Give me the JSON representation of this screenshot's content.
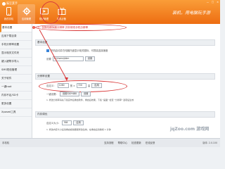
{
  "app": {
    "title": "豌豆荚手"
  },
  "toolbar": [
    {
      "label": "我的手机",
      "icon": "phone-icon"
    },
    {
      "label": "应用管理",
      "icon": "gear-icon",
      "active": true
    },
    {
      "label": "视频管理",
      "icon": "video-icon"
    },
    {
      "label": "装机必备",
      "icon": "gift-icon"
    }
  ],
  "slogan": "装机，用电脑玩手游",
  "window_controls": [
    "—",
    "□",
    "×"
  ],
  "sidebar": [
    {
      "label": "基本设置",
      "active": true
    },
    {
      "label": "应用下载目录"
    },
    {
      "label": "手机分辨率设置"
    },
    {
      "label": "显示相关文件夹"
    },
    {
      "label": "键入键帮手导入"
    },
    {
      "label": "SMS短信管理"
    },
    {
      "label": "关于软件"
    },
    {
      "label": "一键root"
    },
    {
      "label": "内存不足/SD卡"
    },
    {
      "label": "更多设置"
    },
    {
      "label": "Xposed工具"
    }
  ],
  "warning": {
    "badge": "!",
    "text": "注：仅修改模拟器分辨率 并非修改手机分辨率"
  },
  "sections": {
    "basic": {
      "title": "基本设置",
      "checkbox_label": "开机启动并在电脑托盘显示相关图标，可提高连接速度",
      "label": "设置",
      "dir_value": "C:\\Users\\Adm",
      "button": "设置"
    },
    "resolution": {
      "title": "分辨率设置",
      "prefix": "自定义：",
      "width": "1280",
      "sep": "宽 ×",
      "height": "720",
      "height_suffix": "高",
      "apply": "应用",
      "note1": "一键设置：",
      "btn1": "设置320*480",
      "btn2": "设置",
      "note2": "1. 修改分辨率请先下载完毕后重启软件，重启后效果，下载 \"画面\" 检查 \"分辨率\" 选项后生效"
    },
    "memory": {
      "title": "内存调优",
      "prefix": "自定义大小：",
      "value": "768",
      "apply": "应用",
      "note": "1. 修改内存大小后请重启模拟器使修改生效，在重启后请等候 1 分钟"
    }
  },
  "bottom": {
    "left": "手机机",
    "items": [
      "支持流程",
      "帮助中心",
      "检查更新",
      "在线反馈"
    ],
    "version": "版本: 2.0.100"
  },
  "watermark": "jqZoo.com 游戏网"
}
